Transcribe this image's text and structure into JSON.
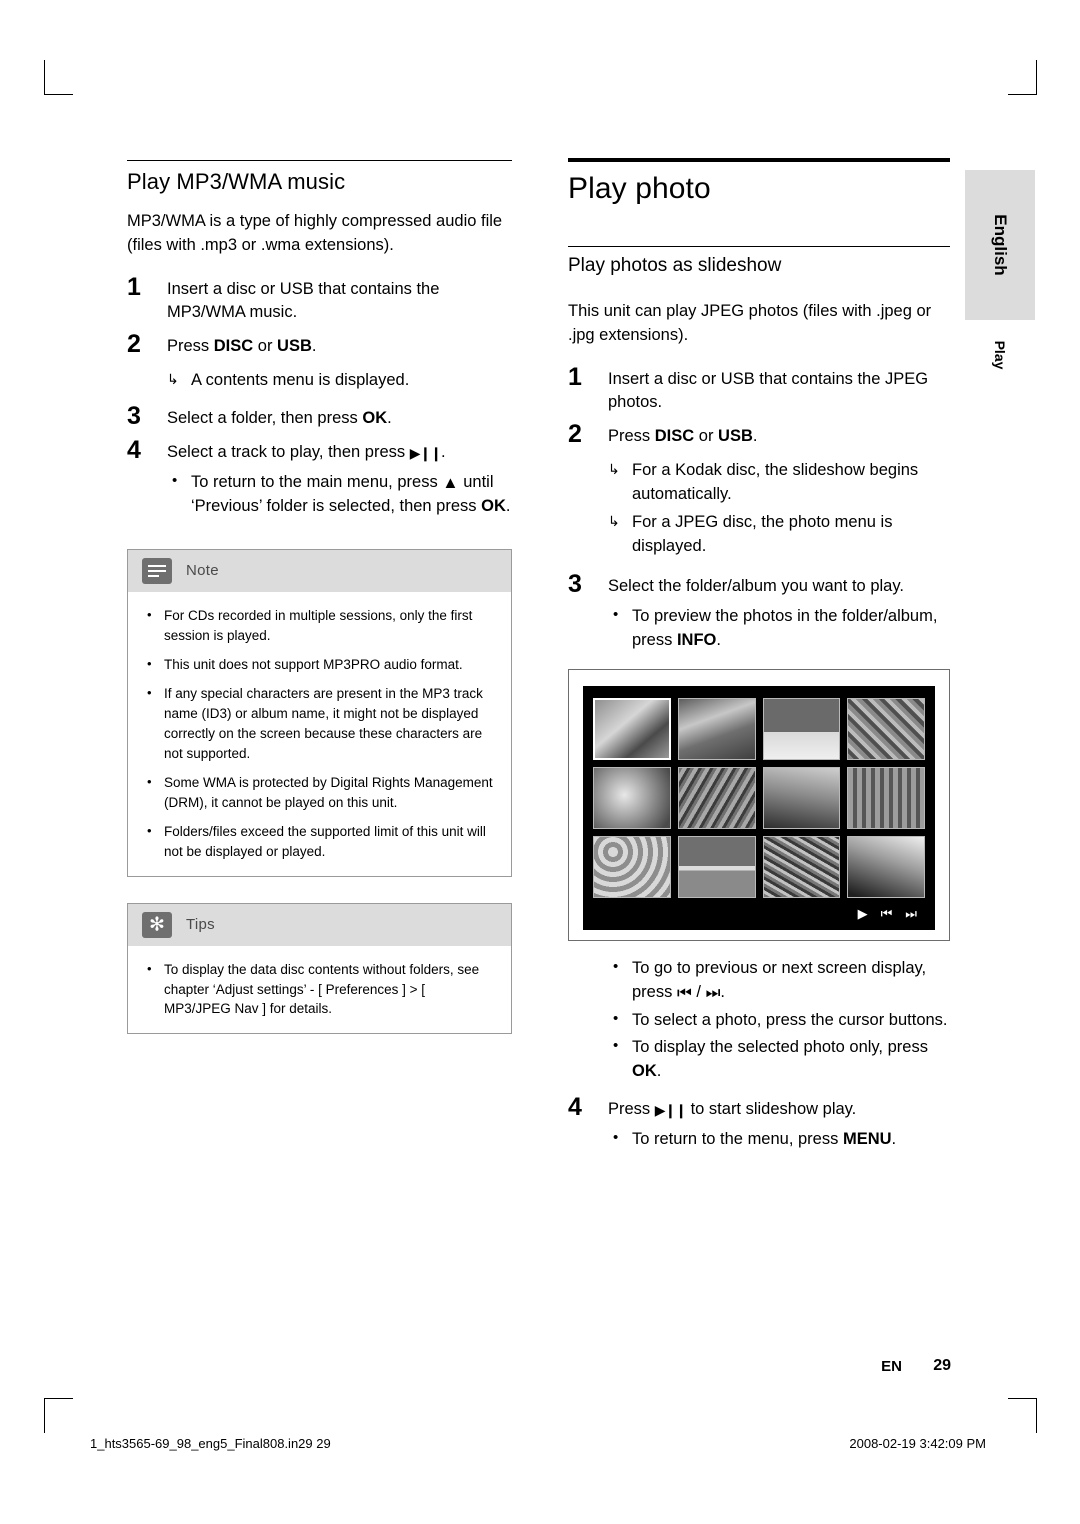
{
  "document": {
    "left_column": {
      "heading": "Play MP3/WMA music",
      "intro": "MP3/WMA is a type of highly compressed audio file (files with .mp3 or .wma extensions).",
      "steps": [
        {
          "num": "1",
          "text": "Insert a disc or USB that contains the MP3/WMA music."
        },
        {
          "num": "2",
          "text_pre": "Press ",
          "kw1": "DISC",
          "text_mid": " or ",
          "kw2": "USB",
          "text_post": "."
        },
        {
          "num": "3",
          "text_pre": "Select a folder, then press ",
          "kw1": "OK",
          "text_post": "."
        },
        {
          "num": "4",
          "text_pre": "Select a track to play, then press ",
          "glyph": "play-pause",
          "text_post": "."
        }
      ],
      "step2_arrow": "A contents menu is displayed.",
      "step4_bullet_pre": "To return to the main menu, press ",
      "step4_bullet_mid": " until ‘Previous’ folder is selected, then press ",
      "step4_bullet_kw": "OK",
      "step4_bullet_post": ".",
      "note_box": {
        "title": "Note",
        "items": [
          "For CDs recorded in multiple sessions, only the first session is played.",
          "This unit does not support MP3PRO audio format.",
          "If any special characters are present in the MP3 track name (ID3) or album name, it might not be displayed correctly on the screen because these characters are not supported.",
          "Some WMA is protected by Digital Rights Management (DRM), it cannot be played on this unit.",
          "Folders/files exceed the supported limit of this unit will not be displayed or played."
        ]
      },
      "tips_box": {
        "title": "Tips",
        "items": [
          "To display the data disc contents without folders, see chapter ‘Adjust settings’ - [ Preferences ] > [ MP3/JPEG Nav ] for details."
        ]
      }
    },
    "right_column": {
      "heading": "Play photo",
      "subheading": "Play photos as slideshow",
      "intro": "This unit can play JPEG photos (files with .jpeg or .jpg extensions).",
      "steps": [
        {
          "num": "1",
          "text": "Insert a disc or USB that contains the JPEG photos."
        },
        {
          "num": "2",
          "text_pre": "Press ",
          "kw1": "DISC",
          "text_mid": " or ",
          "kw2": "USB",
          "text_post": "."
        },
        {
          "num": "3",
          "text": "Select the folder/album you want to play."
        },
        {
          "num": "4",
          "text_pre": "Press ",
          "glyph": "play-pause",
          "text_post": " to start slideshow play."
        }
      ],
      "step2_arrows": [
        "For a Kodak disc, the slideshow begins automatically.",
        "For a JPEG disc, the photo menu is displayed."
      ],
      "step3_bullet_pre": "To preview the photos in the folder/album, press ",
      "step3_bullet_kw": "INFO",
      "step3_bullet_post": ".",
      "screen_bullets": [
        {
          "pre": "To go to previous or next screen display, press ",
          "mid": " / ",
          "post": "."
        },
        {
          "pre": "To select a photo, press the cursor buttons.",
          "mid": "",
          "post": ""
        },
        {
          "pre": "To display the selected photo only, press ",
          "kw": "OK",
          "post": "."
        }
      ],
      "step4_bullet_pre": "To return to the menu, press ",
      "step4_bullet_kw": "MENU",
      "step4_bullet_post": "."
    },
    "side_tab": "English",
    "side_label": "Play",
    "footer": {
      "page_lang": "EN",
      "page_number": "29",
      "file_info": "1_hts3565-69_98_eng5_Final808.in29   29",
      "timestamp": "2008-02-19   3:42:09 PM"
    }
  }
}
